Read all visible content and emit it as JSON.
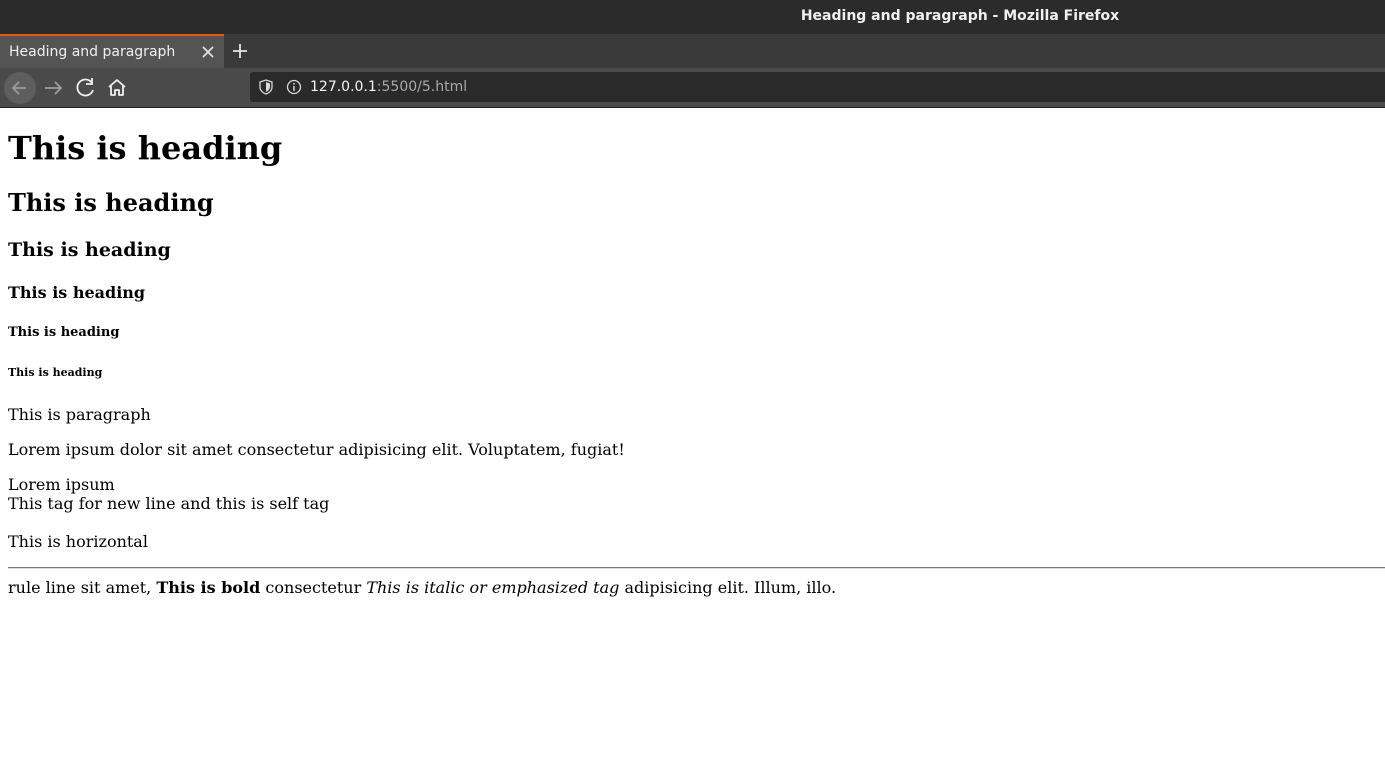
{
  "window": {
    "title": "Heading and paragraph - Mozilla Firefox"
  },
  "tabs": [
    {
      "label": "Heading and paragraph",
      "active": true
    }
  ],
  "toolbar": {
    "back_icon": "arrow-left",
    "forward_icon": "arrow-right",
    "reload_icon": "reload",
    "home_icon": "home"
  },
  "url": {
    "host": "127.0.0.1",
    "rest": ":5500/5.html"
  },
  "page": {
    "h1": "This is heading",
    "h2": "This is heading",
    "h3": "This is heading",
    "h4": "This is heading",
    "h5": "This is heading",
    "h6": "This is heading",
    "p1": "This is paragraph",
    "p2": "Lorem ipsum dolor sit amet consectetur adipisicing elit. Voluptatem, fugiat!",
    "p3_line1": "Lorem ipsum",
    "p3_line2": "This tag for new line and this is self tag",
    "p4": "This is horizontal",
    "p5_a": "rule line sit amet, ",
    "p5_bold": "This is bold",
    "p5_b": " consectetur ",
    "p5_italic": "This is italic or emphasized tag",
    "p5_c": " adipisicing elit. Illum, illo."
  },
  "colors": {
    "titlebar": "#2b2b2b",
    "tab_accent": "#e95420",
    "urlbar": "#2a2a2a"
  }
}
